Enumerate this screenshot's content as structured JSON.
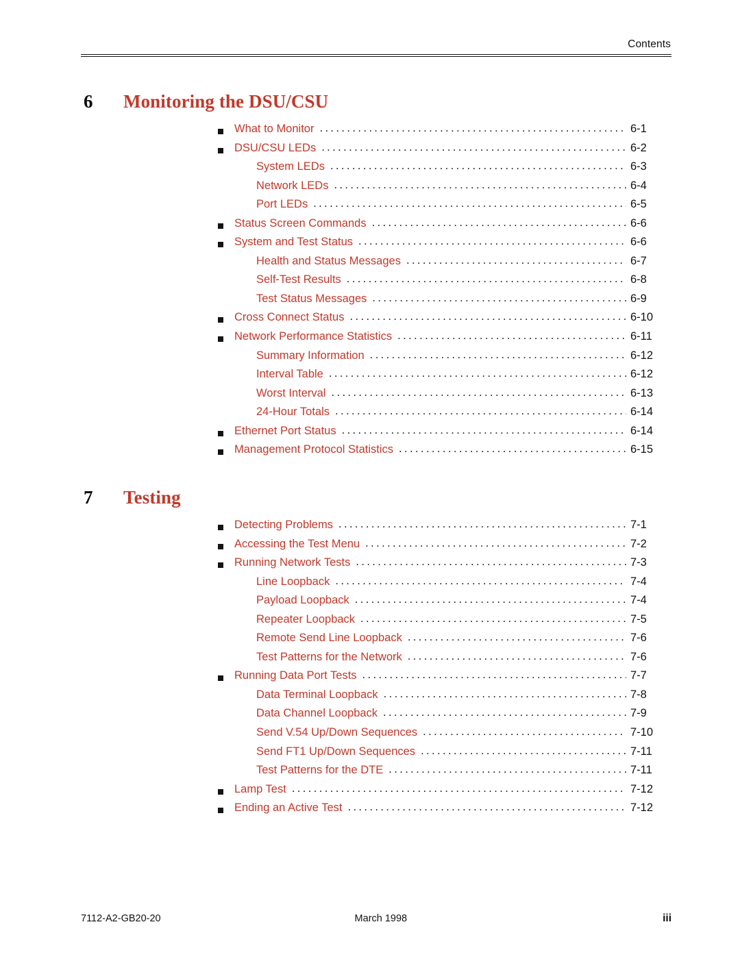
{
  "header": {
    "label": "Contents"
  },
  "chapters": [
    {
      "number": "6",
      "title": "Monitoring the DSU/CSU",
      "entries": [
        {
          "level": 1,
          "label": "What to Monitor",
          "page": "6-1"
        },
        {
          "level": 1,
          "label": "DSU/CSU LEDs",
          "page": "6-2"
        },
        {
          "level": 2,
          "label": "System LEDs",
          "page": "6-3"
        },
        {
          "level": 2,
          "label": "Network LEDs",
          "page": "6-4"
        },
        {
          "level": 2,
          "label": "Port LEDs",
          "page": "6-5"
        },
        {
          "level": 1,
          "label": "Status Screen Commands",
          "page": "6-6"
        },
        {
          "level": 1,
          "label": "System and Test Status",
          "page": "6-6"
        },
        {
          "level": 2,
          "label": "Health and Status Messages",
          "page": "6-7"
        },
        {
          "level": 2,
          "label": "Self-Test Results",
          "page": "6-8"
        },
        {
          "level": 2,
          "label": "Test Status Messages",
          "page": "6-9"
        },
        {
          "level": 1,
          "label": "Cross Connect Status",
          "page": "6-10"
        },
        {
          "level": 1,
          "label": "Network Performance Statistics",
          "page": "6-11"
        },
        {
          "level": 2,
          "label": "Summary Information",
          "page": "6-12"
        },
        {
          "level": 2,
          "label": "Interval Table",
          "page": "6-12"
        },
        {
          "level": 2,
          "label": "Worst Interval",
          "page": "6-13"
        },
        {
          "level": 2,
          "label": "24-Hour Totals",
          "page": "6-14"
        },
        {
          "level": 1,
          "label": "Ethernet Port Status",
          "page": "6-14"
        },
        {
          "level": 1,
          "label": "Management Protocol Statistics",
          "page": "6-15"
        }
      ]
    },
    {
      "number": "7",
      "title": "Testing",
      "entries": [
        {
          "level": 1,
          "label": "Detecting Problems",
          "page": "7-1"
        },
        {
          "level": 1,
          "label": "Accessing the Test Menu",
          "page": "7-2"
        },
        {
          "level": 1,
          "label": "Running Network Tests",
          "page": "7-3"
        },
        {
          "level": 2,
          "label": "Line Loopback",
          "page": "7-4"
        },
        {
          "level": 2,
          "label": "Payload Loopback",
          "page": "7-4"
        },
        {
          "level": 2,
          "label": "Repeater Loopback",
          "page": "7-5"
        },
        {
          "level": 2,
          "label": "Remote Send Line Loopback",
          "page": "7-6"
        },
        {
          "level": 2,
          "label": "Test Patterns for the Network",
          "page": "7-6"
        },
        {
          "level": 1,
          "label": "Running Data Port Tests",
          "page": "7-7"
        },
        {
          "level": 2,
          "label": "Data Terminal Loopback",
          "page": "7-8"
        },
        {
          "level": 2,
          "label": "Data Channel Loopback",
          "page": "7-9"
        },
        {
          "level": 2,
          "label": "Send V.54 Up/Down Sequences",
          "page": "7-10"
        },
        {
          "level": 2,
          "label": "Send FT1 Up/Down Sequences",
          "page": "7-11"
        },
        {
          "level": 2,
          "label": "Test Patterns for the DTE",
          "page": "7-11"
        },
        {
          "level": 1,
          "label": "Lamp Test",
          "page": "7-12"
        },
        {
          "level": 1,
          "label": "Ending an Active Test",
          "page": "7-12"
        }
      ]
    }
  ],
  "footer": {
    "document_number": "7112-A2-GB20-20",
    "date": "March 1998",
    "page_number": "iii"
  },
  "colors": {
    "accent_red": "#C1392B",
    "text_black": "#111111"
  },
  "leader_char": "."
}
